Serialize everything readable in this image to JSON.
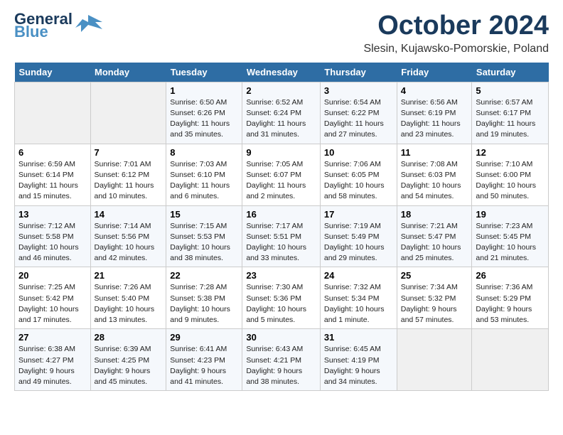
{
  "header": {
    "logo_line1": "General",
    "logo_line2": "Blue",
    "month": "October 2024",
    "location": "Slesin, Kujawsko-Pomorskie, Poland"
  },
  "days_of_week": [
    "Sunday",
    "Monday",
    "Tuesday",
    "Wednesday",
    "Thursday",
    "Friday",
    "Saturday"
  ],
  "weeks": [
    [
      {
        "num": "",
        "detail": ""
      },
      {
        "num": "",
        "detail": ""
      },
      {
        "num": "1",
        "detail": "Sunrise: 6:50 AM\nSunset: 6:26 PM\nDaylight: 11 hours\nand 35 minutes."
      },
      {
        "num": "2",
        "detail": "Sunrise: 6:52 AM\nSunset: 6:24 PM\nDaylight: 11 hours\nand 31 minutes."
      },
      {
        "num": "3",
        "detail": "Sunrise: 6:54 AM\nSunset: 6:22 PM\nDaylight: 11 hours\nand 27 minutes."
      },
      {
        "num": "4",
        "detail": "Sunrise: 6:56 AM\nSunset: 6:19 PM\nDaylight: 11 hours\nand 23 minutes."
      },
      {
        "num": "5",
        "detail": "Sunrise: 6:57 AM\nSunset: 6:17 PM\nDaylight: 11 hours\nand 19 minutes."
      }
    ],
    [
      {
        "num": "6",
        "detail": "Sunrise: 6:59 AM\nSunset: 6:14 PM\nDaylight: 11 hours\nand 15 minutes."
      },
      {
        "num": "7",
        "detail": "Sunrise: 7:01 AM\nSunset: 6:12 PM\nDaylight: 11 hours\nand 10 minutes."
      },
      {
        "num": "8",
        "detail": "Sunrise: 7:03 AM\nSunset: 6:10 PM\nDaylight: 11 hours\nand 6 minutes."
      },
      {
        "num": "9",
        "detail": "Sunrise: 7:05 AM\nSunset: 6:07 PM\nDaylight: 11 hours\nand 2 minutes."
      },
      {
        "num": "10",
        "detail": "Sunrise: 7:06 AM\nSunset: 6:05 PM\nDaylight: 10 hours\nand 58 minutes."
      },
      {
        "num": "11",
        "detail": "Sunrise: 7:08 AM\nSunset: 6:03 PM\nDaylight: 10 hours\nand 54 minutes."
      },
      {
        "num": "12",
        "detail": "Sunrise: 7:10 AM\nSunset: 6:00 PM\nDaylight: 10 hours\nand 50 minutes."
      }
    ],
    [
      {
        "num": "13",
        "detail": "Sunrise: 7:12 AM\nSunset: 5:58 PM\nDaylight: 10 hours\nand 46 minutes."
      },
      {
        "num": "14",
        "detail": "Sunrise: 7:14 AM\nSunset: 5:56 PM\nDaylight: 10 hours\nand 42 minutes."
      },
      {
        "num": "15",
        "detail": "Sunrise: 7:15 AM\nSunset: 5:53 PM\nDaylight: 10 hours\nand 38 minutes."
      },
      {
        "num": "16",
        "detail": "Sunrise: 7:17 AM\nSunset: 5:51 PM\nDaylight: 10 hours\nand 33 minutes."
      },
      {
        "num": "17",
        "detail": "Sunrise: 7:19 AM\nSunset: 5:49 PM\nDaylight: 10 hours\nand 29 minutes."
      },
      {
        "num": "18",
        "detail": "Sunrise: 7:21 AM\nSunset: 5:47 PM\nDaylight: 10 hours\nand 25 minutes."
      },
      {
        "num": "19",
        "detail": "Sunrise: 7:23 AM\nSunset: 5:45 PM\nDaylight: 10 hours\nand 21 minutes."
      }
    ],
    [
      {
        "num": "20",
        "detail": "Sunrise: 7:25 AM\nSunset: 5:42 PM\nDaylight: 10 hours\nand 17 minutes."
      },
      {
        "num": "21",
        "detail": "Sunrise: 7:26 AM\nSunset: 5:40 PM\nDaylight: 10 hours\nand 13 minutes."
      },
      {
        "num": "22",
        "detail": "Sunrise: 7:28 AM\nSunset: 5:38 PM\nDaylight: 10 hours\nand 9 minutes."
      },
      {
        "num": "23",
        "detail": "Sunrise: 7:30 AM\nSunset: 5:36 PM\nDaylight: 10 hours\nand 5 minutes."
      },
      {
        "num": "24",
        "detail": "Sunrise: 7:32 AM\nSunset: 5:34 PM\nDaylight: 10 hours\nand 1 minute."
      },
      {
        "num": "25",
        "detail": "Sunrise: 7:34 AM\nSunset: 5:32 PM\nDaylight: 9 hours\nand 57 minutes."
      },
      {
        "num": "26",
        "detail": "Sunrise: 7:36 AM\nSunset: 5:29 PM\nDaylight: 9 hours\nand 53 minutes."
      }
    ],
    [
      {
        "num": "27",
        "detail": "Sunrise: 6:38 AM\nSunset: 4:27 PM\nDaylight: 9 hours\nand 49 minutes."
      },
      {
        "num": "28",
        "detail": "Sunrise: 6:39 AM\nSunset: 4:25 PM\nDaylight: 9 hours\nand 45 minutes."
      },
      {
        "num": "29",
        "detail": "Sunrise: 6:41 AM\nSunset: 4:23 PM\nDaylight: 9 hours\nand 41 minutes."
      },
      {
        "num": "30",
        "detail": "Sunrise: 6:43 AM\nSunset: 4:21 PM\nDaylight: 9 hours\nand 38 minutes."
      },
      {
        "num": "31",
        "detail": "Sunrise: 6:45 AM\nSunset: 4:19 PM\nDaylight: 9 hours\nand 34 minutes."
      },
      {
        "num": "",
        "detail": ""
      },
      {
        "num": "",
        "detail": ""
      }
    ]
  ]
}
